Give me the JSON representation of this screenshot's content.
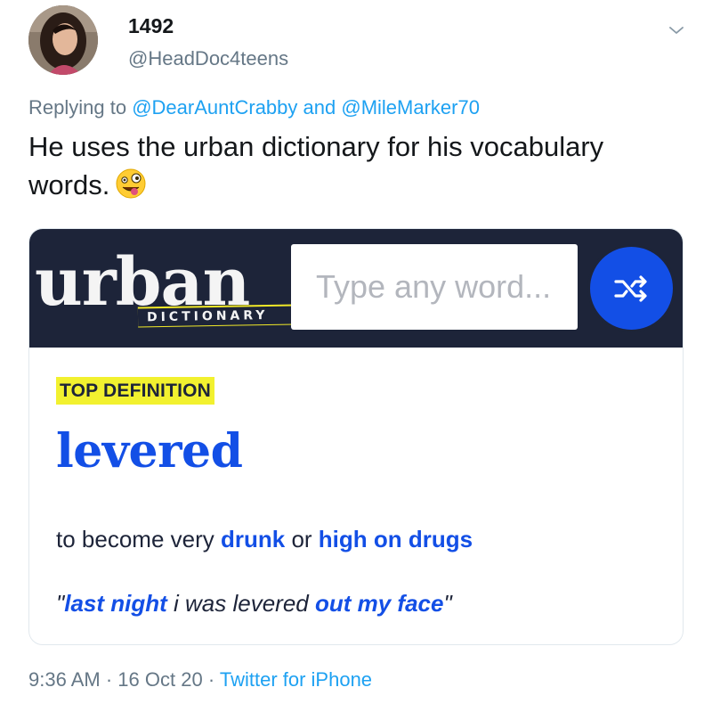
{
  "user": {
    "display_name": "1492",
    "handle": "@HeadDoc4teens"
  },
  "reply": {
    "prefix": "Replying to",
    "mention_1": "@DearAuntCrabby",
    "conjunction": "and",
    "mention_2": "@MileMarker70"
  },
  "tweet": {
    "text": "He uses the urban dictionary for his vocabulary words.",
    "emoji": "zany-face-emoji"
  },
  "card": {
    "logo_word": "urban",
    "logo_tag": "DICTIONARY",
    "search_placeholder": "Type any word...",
    "random_icon": "shuffle-icon",
    "top_label": "TOP DEFINITION",
    "word": "levered",
    "definition": {
      "part_1": "to become very ",
      "link_1": "drunk",
      "part_2": " or ",
      "link_2": "high on drugs"
    },
    "example": {
      "open_quote": "\"",
      "link_1": "last night",
      "middle": " i was levered ",
      "link_2": "out my face",
      "close_quote": "\""
    }
  },
  "meta": {
    "time": "9:36 AM",
    "separator": "·",
    "date": "16 Oct 20",
    "source": "Twitter for iPhone"
  },
  "colors": {
    "twitter_blue": "#1da1f2",
    "ud_navy": "#1d2439",
    "ud_blue": "#134fe6",
    "ud_yellow": "#f2f12f",
    "muted_gray": "#657786"
  }
}
